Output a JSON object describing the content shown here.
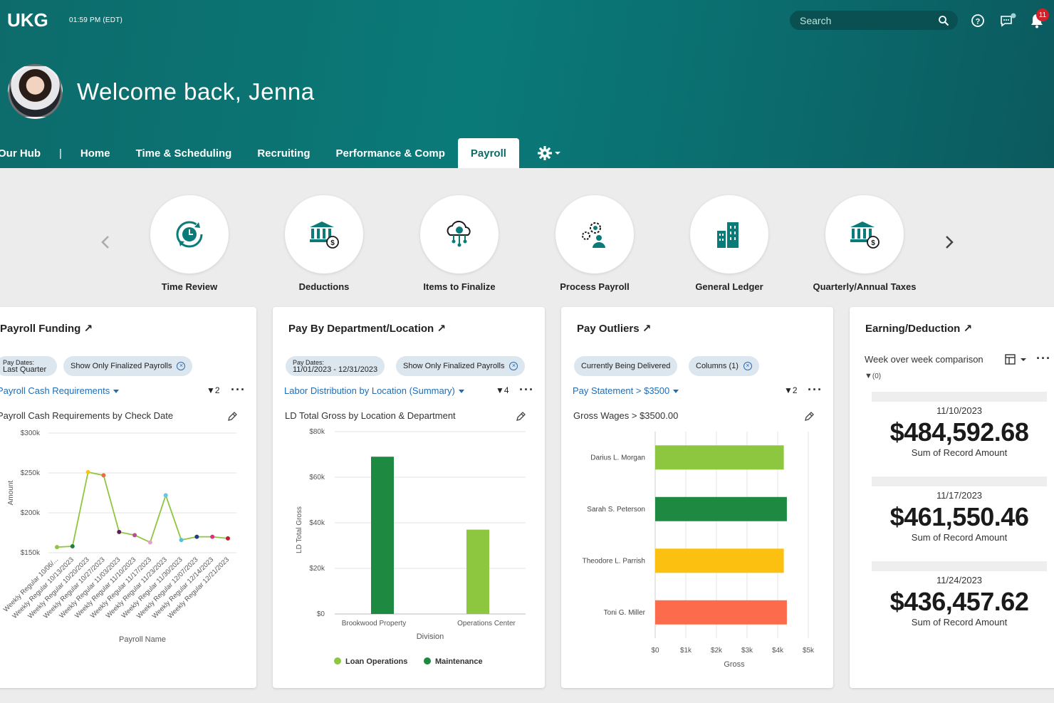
{
  "header": {
    "logo_text": "UKG",
    "time": "01:59 PM (EDT)",
    "search_placeholder": "Search",
    "notification_count": "11",
    "welcome": "Welcome back, Jenna"
  },
  "nav": {
    "items": [
      "Our Hub",
      "Home",
      "Time & Scheduling",
      "Recruiting",
      "Performance & Comp",
      "Payroll"
    ],
    "separator": "|",
    "active": "Payroll"
  },
  "tiles": [
    {
      "label": "Time Review",
      "icon": "clock-refresh-icon"
    },
    {
      "label": "Deductions",
      "icon": "bank-dollar-icon"
    },
    {
      "label": "Items to Finalize",
      "icon": "cloud-network-icon"
    },
    {
      "label": "Process Payroll",
      "icon": "gears-person-icon"
    },
    {
      "label": "General Ledger",
      "icon": "building-icon"
    },
    {
      "label": "Quarterly/Annual Taxes",
      "icon": "bank-dollar-icon"
    }
  ],
  "cards": {
    "funding": {
      "title": "Payroll Funding",
      "chip1_small": "Pay Dates:",
      "chip1_big": "Last Quarter",
      "chip2": "Show Only Finalized Payrolls",
      "link": "Payroll Cash Requirements",
      "filter_count": "2",
      "chart_title": "Payroll Cash Requirements by Check Date"
    },
    "department": {
      "title": "Pay By Department/Location",
      "chip1_small": "Pay Dates:",
      "chip1_big": "11/01/2023 - 12/31/2023",
      "chip2": "Show Only Finalized Payrolls",
      "link": "Labor Distribution by Location (Summary)",
      "filter_count": "4",
      "chart_title": "LD Total Gross by Location & Department"
    },
    "outliers": {
      "title": "Pay Outliers",
      "chip1": "Currently Being Delivered",
      "chip2": "Columns (1)",
      "link": "Pay Statement > $3500",
      "filter_count": "2",
      "chart_title": "Gross Wages > $3500.00"
    },
    "earning": {
      "title": "Earning/Deduction",
      "subtitle": "Week over week comparison",
      "filter": "(0)",
      "metrics": [
        {
          "date": "11/10/2023",
          "value": "$484,592.68",
          "label": "Sum of Record Amount"
        },
        {
          "date": "11/17/2023",
          "value": "$461,550.46",
          "label": "Sum of Record Amount"
        },
        {
          "date": "11/24/2023",
          "value": "$436,457.62",
          "label": "Sum of Record Amount"
        }
      ]
    }
  },
  "chart_data": [
    {
      "type": "line",
      "title": "Payroll Cash Requirements by Check Date",
      "xlabel": "Payroll Name",
      "ylabel": "Amount",
      "ylim": [
        150000,
        300000
      ],
      "yticks": [
        "$150k",
        "$200k",
        "$250k",
        "$300k"
      ],
      "categories": [
        "Weekly Regular 10/06/...",
        "Weekly Regular 10/13/2023",
        "Weekly Regular 10/20/2023",
        "Weekly Regular 10/27/2023",
        "Weekly Regular 11/03/2023",
        "Weekly Regular 11/10/2023",
        "Weekly Regular 11/17/2023",
        "Weekly Regular 11/23/2023",
        "Weekly Regular 11/30/2023",
        "Weekly Regular 12/07/2023",
        "Weekly Regular 12/14/2023",
        "Weekly Regular 12/21/2023"
      ],
      "values": [
        157000,
        158000,
        251000,
        247000,
        176000,
        172000,
        163000,
        222000,
        166000,
        170000,
        170000,
        168000
      ],
      "point_colors": [
        "#8dc63f",
        "#1e7f3f",
        "#f5c518",
        "#f06a3c",
        "#5a1f55",
        "#c04a9a",
        "#e8a0c8",
        "#6ac2e8",
        "#54c2d8",
        "#1f3f7f",
        "#e0307f",
        "#c0202a"
      ],
      "line_color": "#8dc63f"
    },
    {
      "type": "bar",
      "title": "LD Total Gross by Location & Department",
      "xlabel": "Division",
      "ylabel": "LD Total Gross",
      "ylim": [
        0,
        80000
      ],
      "yticks": [
        "$0",
        "$20k",
        "$40k",
        "$60k",
        "$80k"
      ],
      "categories": [
        "Brookwood Property",
        "Operations Center"
      ],
      "series": [
        {
          "name": "Maintenance",
          "values": [
            69000,
            0
          ],
          "color": "#1e8a41"
        },
        {
          "name": "Loan Operations",
          "values": [
            0,
            37000
          ],
          "color": "#8dc63f"
        }
      ],
      "legend": [
        "Loan Operations",
        "Maintenance"
      ],
      "legend_colors": [
        "#8dc63f",
        "#1e8a41"
      ]
    },
    {
      "type": "bar",
      "orientation": "horizontal",
      "title": "Gross Wages > $3500.00",
      "xlabel": "Gross",
      "xlim": [
        0,
        5000
      ],
      "xticks": [
        "$0",
        "$1k",
        "$2k",
        "$3k",
        "$4k",
        "$5k"
      ],
      "categories": [
        "Darius L. Morgan",
        "Sarah S. Peterson",
        "Theodore L. Parrish",
        "Toni G. Miller"
      ],
      "values": [
        4200,
        4300,
        4200,
        4300
      ],
      "colors": [
        "#8dc63f",
        "#1e8a41",
        "#fcc010",
        "#fc6b4c"
      ]
    }
  ]
}
